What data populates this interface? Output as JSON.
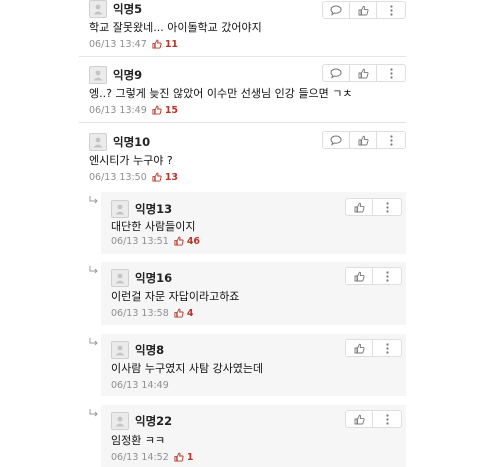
{
  "comments": [
    {
      "nickname": "익명5",
      "text": "학교 잘못왔네... 아이돌학교 갔어야지",
      "timestamp": "06/13 13:47",
      "likes": "11"
    },
    {
      "nickname": "익명9",
      "text": "엥..? 그렇게 늦진 않았어 이수만 선생님 인강 들으면 ㄱㅊ",
      "timestamp": "06/13 13:49",
      "likes": "15"
    },
    {
      "nickname": "익명10",
      "text": "엔시티가 누구야 ?",
      "timestamp": "06/13 13:50",
      "likes": "13"
    }
  ],
  "replies": [
    {
      "nickname": "익명13",
      "text": "대단한 사람들이지",
      "timestamp": "06/13 13:51",
      "likes": "46"
    },
    {
      "nickname": "익명16",
      "text": "이런걸 자문 자답이라고하죠",
      "timestamp": "06/13 13:58",
      "likes": "4"
    },
    {
      "nickname": "익명8",
      "text": "이사람 누구였지 사탐 강사였는데",
      "timestamp": "06/13 14:49",
      "likes": ""
    },
    {
      "nickname": "익명22",
      "text": "임정환 ㅋㅋ",
      "timestamp": "06/13 14:52",
      "likes": "1"
    }
  ],
  "icons": {
    "reply": "speech-bubble-icon",
    "like": "thumbs-up-icon",
    "more": "vertical-ellipsis-icon"
  },
  "colors": {
    "like_count": "#b4382b",
    "reply_background": "#f6f6f6"
  }
}
